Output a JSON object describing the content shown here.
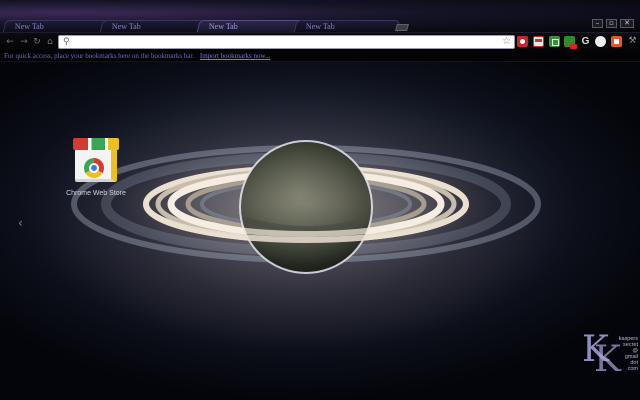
{
  "tabs": [
    {
      "label": "New Tab",
      "active": false
    },
    {
      "label": "New Tab",
      "active": false
    },
    {
      "label": "New Tab",
      "active": true
    },
    {
      "label": "New Tab",
      "active": false
    }
  ],
  "window_controls": {
    "minimize": "–",
    "maximize": "▫",
    "close": "✕"
  },
  "toolbar": {
    "back_icon": "arrow-left-icon",
    "forward_icon": "arrow-right-icon",
    "reload_icon": "reload-icon",
    "home_icon": "home-icon",
    "omnibox_value": "",
    "bookmark_star_icon": "star-icon",
    "extensions": [
      "ext-red-icon",
      "gmail-icon",
      "ext-green-icon",
      "ext-green-badge-icon",
      "google-g-icon",
      "ext-circle-icon",
      "ext-orange-icon"
    ],
    "menu_icon": "wrench-icon"
  },
  "bookmarks_bar": {
    "message": "For quick access, place your bookmarks here on the bookmarks bar.",
    "link": "Import bookmarks now..."
  },
  "apps": [
    {
      "name": "Chrome Web Store",
      "icon": "chrome-web-store-icon"
    }
  ],
  "watermark": {
    "letters": "K",
    "lines": [
      "kaspers",
      "secret",
      "@",
      "gmail",
      "dot",
      "com"
    ]
  },
  "colors": {
    "tab_text": "#8b80c8",
    "bookmark_text": "#6a6ac6",
    "background": "#000000"
  }
}
